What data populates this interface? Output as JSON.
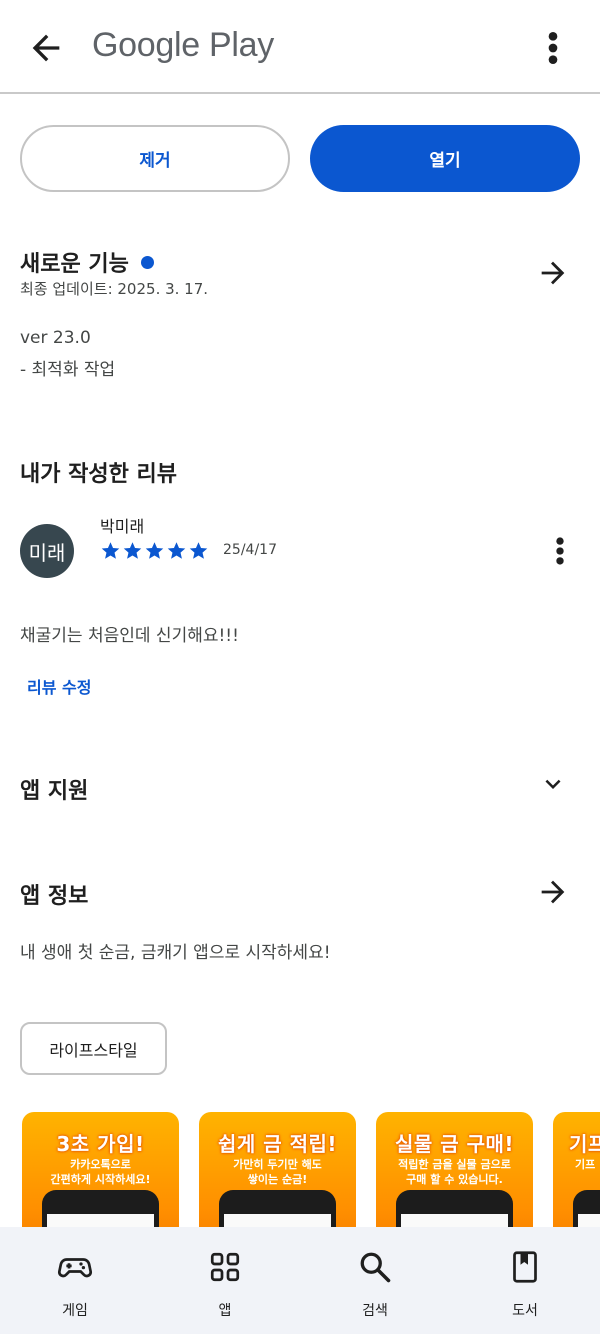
{
  "header": {
    "title": "Google Play"
  },
  "actions": {
    "uninstall": "제거",
    "open": "열기"
  },
  "whats_new": {
    "heading": "새로운 기능",
    "updated": "최종 업데이트: 2025. 3. 17.",
    "version": "ver 23.0",
    "notes": "- 최적화 작업"
  },
  "my_review": {
    "heading": "내가 작성한 리뷰",
    "avatar_text": "미래",
    "reviewer": "박미래",
    "rating": 5,
    "date": "25/4/17",
    "text": "채굴기는 처음인데 신기해요!!!",
    "edit_label": "리뷰 수정"
  },
  "app_support": {
    "heading": "앱 지원"
  },
  "app_info": {
    "heading": "앱 정보",
    "description": "내 생애 첫 순금, 금캐기 앱으로 시작하세요!",
    "category_chip": "라이프스타일"
  },
  "screenshots": [
    {
      "title": "3초 가입!",
      "desc": "카카오톡으로\n간편하게 시작하세요!"
    },
    {
      "title": "쉽게 금 적립!",
      "desc": "가만히 두기만 해도\n쌓이는 순금!"
    },
    {
      "title": "실물 금 구매!",
      "desc": "적립한 금을 실물 금으로\n구매 할 수 있습니다."
    },
    {
      "title": "기프",
      "desc": "기프"
    }
  ],
  "bottom_nav": [
    {
      "label": "게임",
      "icon": "gamepad-icon"
    },
    {
      "label": "앱",
      "icon": "apps-grid-icon"
    },
    {
      "label": "검색",
      "icon": "search-icon"
    },
    {
      "label": "도서",
      "icon": "book-icon"
    }
  ],
  "colors": {
    "accent": "#0b57d0",
    "avatar_bg": "#37474f",
    "nav_bg": "#f1f3f8",
    "screenshot_bg": "#ff9800"
  }
}
